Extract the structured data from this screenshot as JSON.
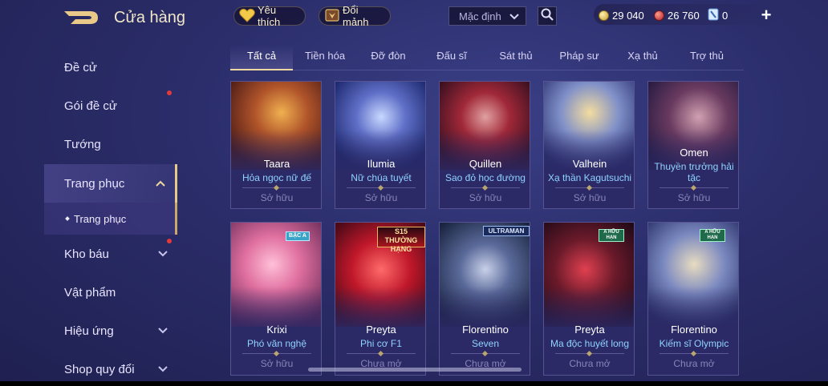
{
  "header": {
    "title": "Cửa hàng",
    "favorites_label": "Yêu thích",
    "exchange_label": "Đổi mảnh",
    "sort_selected": "Mặc định"
  },
  "currency": {
    "gold": "29 040",
    "ruby": "26 760",
    "voucher": "0"
  },
  "sidebar": {
    "items": [
      {
        "label": "Đề cử"
      },
      {
        "label": "Gói đề cử"
      },
      {
        "label": "Tướng"
      },
      {
        "label": "Trang phục"
      },
      {
        "label": "Kho báu"
      },
      {
        "label": "Vật phẩm"
      },
      {
        "label": "Hiệu ứng"
      },
      {
        "label": "Shop quy đổi"
      }
    ],
    "sub_item": "Trang phục"
  },
  "tabs": [
    "Tất cả",
    "Tiền hóa",
    "Đỡ đòn",
    "Đấu sĩ",
    "Sát thủ",
    "Pháp sư",
    "Xạ thủ",
    "Trợ thủ"
  ],
  "cards": [
    {
      "hero": "Taara",
      "skin": "Hỏa ngọc nữ đế",
      "status": "Sở hữu"
    },
    {
      "hero": "Ilumia",
      "skin": "Nữ chúa tuyết",
      "status": "Sở hữu"
    },
    {
      "hero": "Quillen",
      "skin": "Sao đỏ học đường",
      "status": "Sở hữu"
    },
    {
      "hero": "Valhein",
      "skin": "Xạ thần Kagutsuchi",
      "status": "Sở hữu"
    },
    {
      "hero": "Omen",
      "skin": "Thuyền trưởng hải tặc",
      "status": "Sở hữu"
    },
    {
      "hero": "Krixi",
      "skin": "Phó văn nghệ",
      "status": "Sở hữu",
      "badge": "BẬC A"
    },
    {
      "hero": "Preyta",
      "skin": "Phi cơ F1",
      "status": "Chưa mở",
      "badge": "S15 THƯỜNG HẠNG"
    },
    {
      "hero": "Florentino",
      "skin": "Seven",
      "status": "Chưa mở",
      "badge": "ULTRAMAN"
    },
    {
      "hero": "Preyta",
      "skin": "Ma độc huyết long",
      "status": "Chưa mở",
      "badge": "A HỮU HẠN"
    },
    {
      "hero": "Florentino",
      "skin": "Kiếm sĩ Olympic",
      "status": "Chưa mở",
      "badge": "A HỮU HẠN"
    }
  ],
  "colors": {
    "background": "#2b2d6a",
    "skin_name": "#8fd3ff",
    "accent_gold": "#f0d9a0",
    "notification": "#e23a3a"
  }
}
